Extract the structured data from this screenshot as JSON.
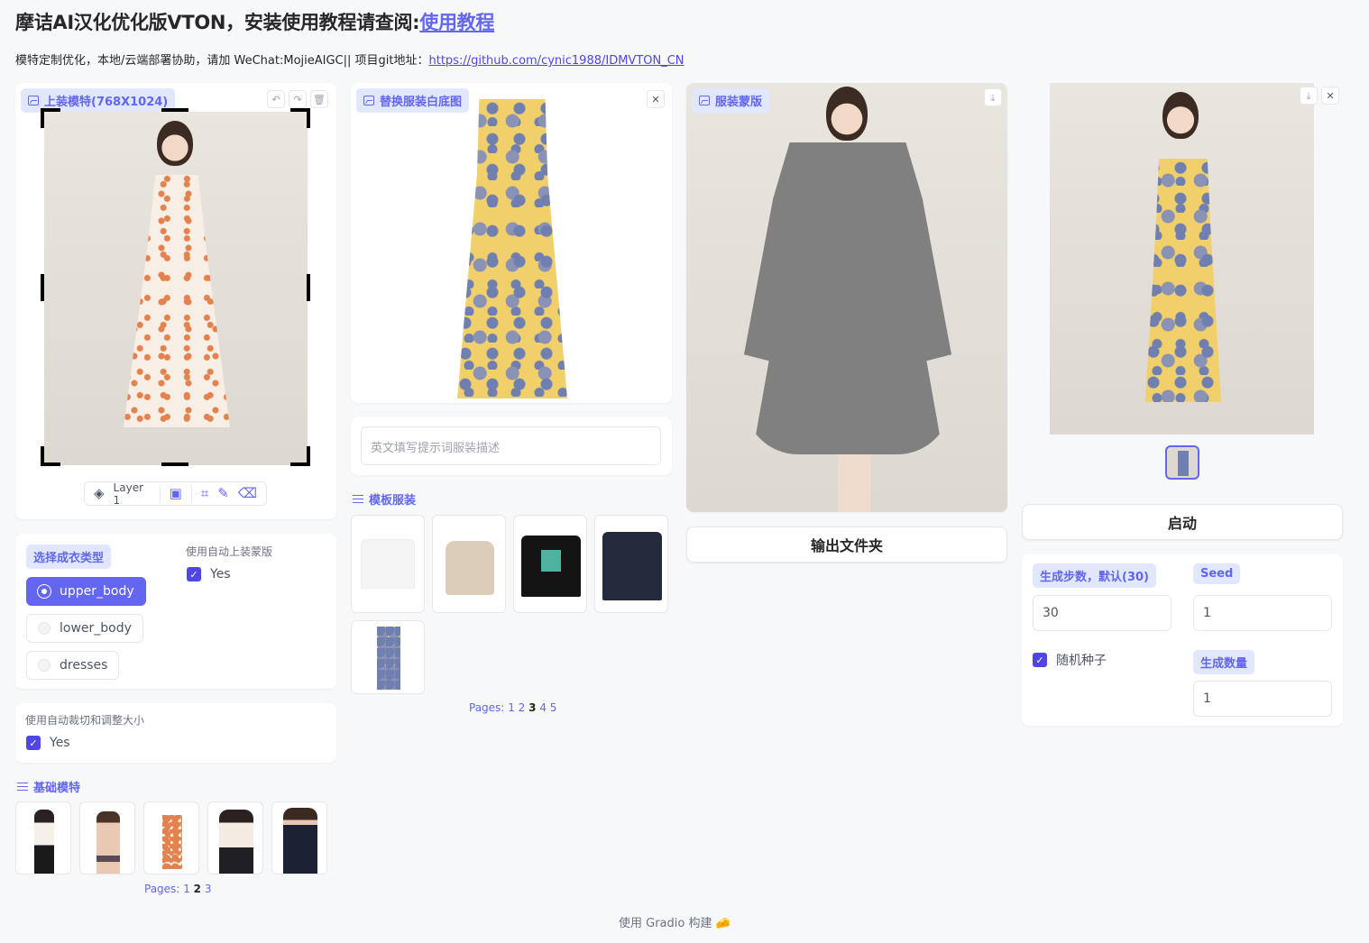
{
  "header": {
    "title_prefix": "摩诘AI汉化优化版VTON，安装使用教程请查阅:",
    "title_link": "使用教程",
    "subtitle_prefix": "模特定制优化，本地/云端部署协助，请加 WeChat:MojieAIGC|| 项目git地址：",
    "subtitle_link": "https://github.com/cynic1988/IDMVTON_CN"
  },
  "model_input": {
    "label": "上装模特(768X1024)",
    "toolbar": {
      "layer": "Layer 1"
    },
    "icons": [
      "undo-icon",
      "redo-icon",
      "trash-icon"
    ]
  },
  "garment_input": {
    "label": "替换服装白底图",
    "prompt_placeholder": "英文填写提示词服装描述"
  },
  "mask_output": {
    "label": "服装蒙版"
  },
  "template_garments": {
    "label": "模板服装",
    "pages_prefix": "Pages:",
    "pages": [
      "1",
      "2",
      "3",
      "4",
      "5"
    ],
    "current_page": "3"
  },
  "garment_type": {
    "label": "选择成衣类型",
    "options": [
      "upper_body",
      "lower_body",
      "dresses"
    ],
    "selected": "upper_body"
  },
  "auto_mask": {
    "label": "使用自动上装蒙版",
    "option": "Yes",
    "checked": true
  },
  "auto_crop": {
    "label": "使用自动裁切和调整大小",
    "option": "Yes",
    "checked": true
  },
  "base_models": {
    "label": "基础模特",
    "pages_prefix": "Pages:",
    "pages": [
      "1",
      "2",
      "3"
    ],
    "current_page": "2"
  },
  "output_folder_button": "输出文件夹",
  "start_button": "启动",
  "settings": {
    "steps_label": "生成步数，默认(30)",
    "steps_value": "30",
    "seed_label": "Seed",
    "seed_value": "1",
    "random_seed_label": "随机种子",
    "random_seed_checked": true,
    "count_label": "生成数量",
    "count_value": "1"
  },
  "footer": "使用 Gradio 构建 🧀",
  "colors": {
    "accent": "#6366f1",
    "accent_light": "#e0e7ff",
    "checkbox": "#4f46e5"
  }
}
